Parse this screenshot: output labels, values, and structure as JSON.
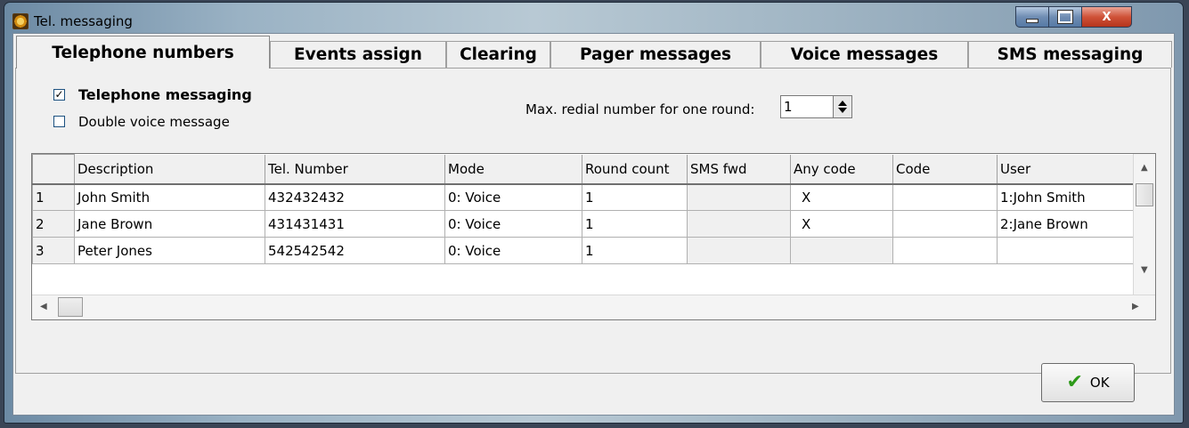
{
  "window": {
    "title": "Tel. messaging",
    "controls": {
      "minimize": "–",
      "maximize": "□",
      "close": "X"
    }
  },
  "tabs": [
    {
      "label": "Telephone numbers",
      "active": true
    },
    {
      "label": "Events assign",
      "active": false
    },
    {
      "label": "Clearing",
      "active": false
    },
    {
      "label": "Pager messages",
      "active": false
    },
    {
      "label": "Voice messages",
      "active": false
    },
    {
      "label": "SMS messaging",
      "active": false
    }
  ],
  "options": {
    "telephone_messaging": {
      "label": "Telephone messaging",
      "checked": true
    },
    "double_voice_message": {
      "label": "Double voice message",
      "checked": false
    },
    "max_redial_label": "Max. redial number for one round:",
    "max_redial_value": "1"
  },
  "grid": {
    "columns": [
      "",
      "Description",
      "Tel. Number",
      "Mode",
      "Round count",
      "SMS fwd",
      "Any code",
      "Code",
      "User"
    ],
    "rows": [
      [
        "1",
        "John Smith",
        "432432432",
        "0: Voice",
        "1",
        "",
        "X",
        "",
        "1:John Smith"
      ],
      [
        "2",
        "Jane Brown",
        "431431431",
        "0: Voice",
        "1",
        "",
        "X",
        "",
        "2:Jane Brown"
      ],
      [
        "3",
        "Peter Jones",
        "542542542",
        "0: Voice",
        "1",
        "",
        "",
        "",
        ""
      ]
    ]
  },
  "buttons": {
    "ok": "OK"
  }
}
